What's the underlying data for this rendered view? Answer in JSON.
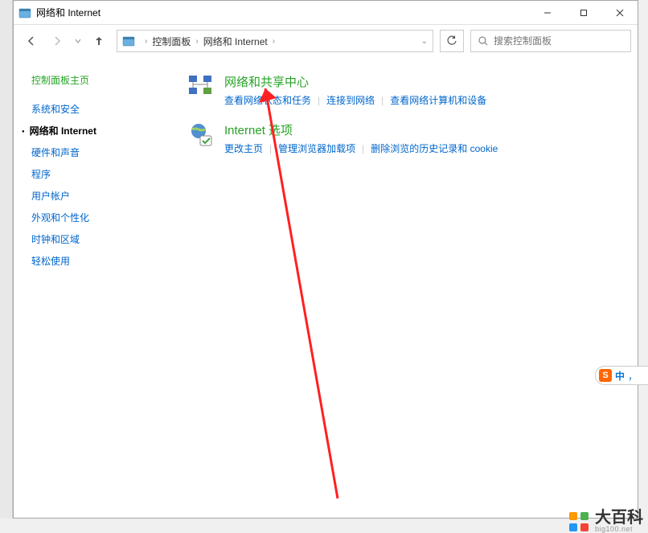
{
  "window": {
    "title": "网络和 Internet"
  },
  "breadcrumb": {
    "seg1": "控制面板",
    "seg2": "网络和 Internet"
  },
  "search": {
    "placeholder": "搜索控制面板"
  },
  "sidebar": {
    "title": "控制面板主页",
    "items": [
      {
        "label": "系统和安全",
        "active": false
      },
      {
        "label": "网络和 Internet",
        "active": true
      },
      {
        "label": "硬件和声音",
        "active": false
      },
      {
        "label": "程序",
        "active": false
      },
      {
        "label": "用户帐户",
        "active": false
      },
      {
        "label": "外观和个性化",
        "active": false
      },
      {
        "label": "时钟和区域",
        "active": false
      },
      {
        "label": "轻松使用",
        "active": false
      }
    ]
  },
  "main": {
    "cat1": {
      "title": "网络和共享中心",
      "link1": "查看网络状态和任务",
      "link2": "连接到网络",
      "link3": "查看网络计算机和设备"
    },
    "cat2": {
      "title": "Internet 选项",
      "link1": "更改主页",
      "link2": "管理浏览器加载项",
      "link3": "删除浏览的历史记录和 cookie"
    }
  },
  "ime": {
    "logo": "S",
    "mode": "中",
    "punct": "，"
  },
  "watermark": {
    "brand": "大百科",
    "url": "big100.net"
  }
}
